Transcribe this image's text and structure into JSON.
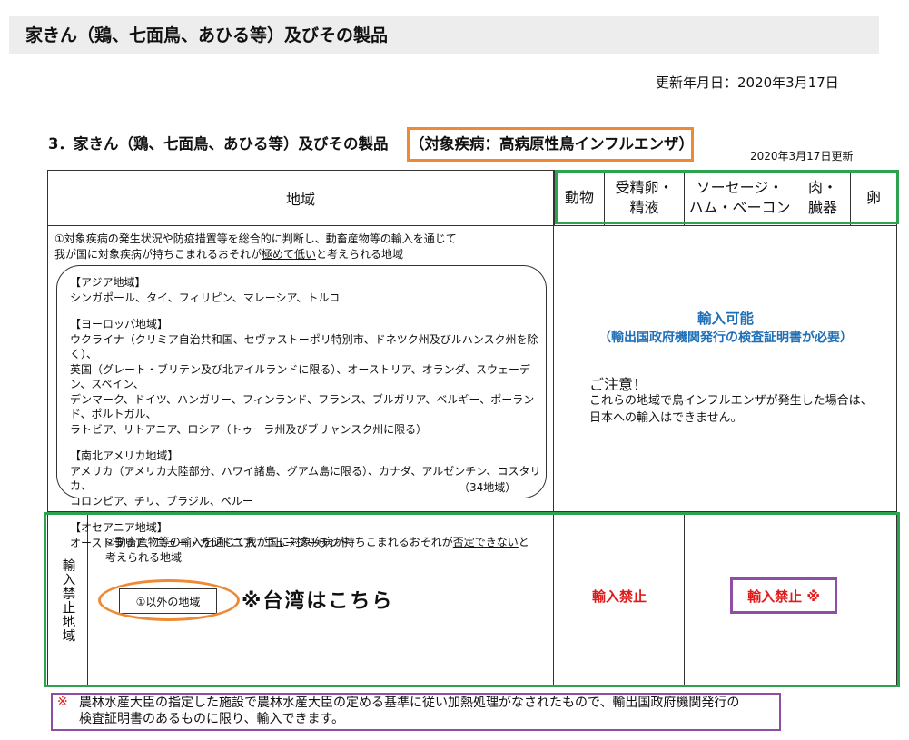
{
  "header": {
    "title": "家きん（鶏、七面鳥、あひる等）及びその製品"
  },
  "updated": "更新年月日：2020年3月17日",
  "section": {
    "title": "3．家きん（鶏、七面鳥、あひる等）及びその製品",
    "disease": "（対象疾病：高病原性鳥インフルエンザ）",
    "table_date": "2020年3月17日更新"
  },
  "table": {
    "region_header": "地域",
    "columns": [
      "動物",
      "受精卵・精液",
      "ソーセージ・ハム・ベーコン",
      "肉・臓器",
      "卵"
    ],
    "columns_lines": [
      [
        "動物"
      ],
      [
        "受精卵・",
        "精液"
      ],
      [
        "ソーセージ・",
        "ハム・ベーコン"
      ],
      [
        "肉・",
        "臓器"
      ],
      [
        "卵"
      ]
    ],
    "row1": {
      "intro_1": "①対象疾病の発生状況や防疫措置等を総合的に判断し、動畜産物等の輸入を通じて",
      "intro_2a": "我が国に対象疾病が持ちこまれるおそれが",
      "intro_2u": "極めて低い",
      "intro_2b": "と考えられる地域",
      "regions": [
        {
          "label": "【アジア地域】",
          "lines": [
            "シンガポール、タイ、フィリピン、マレーシア、トルコ"
          ]
        },
        {
          "label": "【ヨーロッパ地域】",
          "lines": [
            "ウクライナ（クリミア自治共和国、セヴァストーポリ特別市、ドネツク州及びルハンスク州を除く）、",
            "英国（グレート・ブリテン及び北アイルランドに限る）、オーストリア、オランダ、スウェーデン、スペイン、",
            "デンマーク、ドイツ、ハンガリー、フィンランド、フランス、ブルガリア、ベルギー、ポーランド、ポルトガル、",
            "ラトビア、リトアニア、ロシア（トゥーラ州及びブリャンスク州に限る）"
          ]
        },
        {
          "label": "【南北アメリカ地域】",
          "lines": [
            "アメリカ（アメリカ大陸部分、ハワイ諸島、グアム島に限る）、カナダ、アルゼンチン、コスタリカ、",
            "コロンビア、チリ、ブラジル、ペルー"
          ]
        },
        {
          "label": "【オセアニア地域】",
          "lines": [
            "オーストラリア、ニュー・カレドニア、ニュージーランド"
          ]
        }
      ],
      "count": "（34地域）",
      "allowed_title": "輸入可能",
      "allowed_sub": "（輸出国政府機関発行の検査証明書が必要）",
      "caution_title": "ご注意！",
      "caution_line1": "これらの地域で鳥インフルエンザが発生した場合は、",
      "caution_line2": "日本への輸入はできません。"
    },
    "row2": {
      "side_label": "輸入禁止地域",
      "intro_1a": "②動畜産物等の輸入を通じて我が国に対象疾病が持ちこまれるおそれが",
      "intro_1u": "否定できない",
      "intro_1b": "と",
      "intro_2": "考えられる地域",
      "other_regions": "①以外の地域",
      "taiwan_note": "※台湾はこちら",
      "prohibited": "輸入禁止",
      "prohibited_note": "輸入禁止 ※"
    }
  },
  "footnote": {
    "mark": "※",
    "line1": "農林水産大臣の指定した施設で農林水産大臣の定める基準に従い加熱処理がなされたもので、輸出国政府機関発行の",
    "line2": "検査証明書のあるものに限り、輸入できます。"
  },
  "colors": {
    "orange": "#ef8a34",
    "green": "#2ea34f",
    "purple": "#8e4ea3",
    "blue": "#1f6fb6",
    "red": "#e01a1a"
  }
}
